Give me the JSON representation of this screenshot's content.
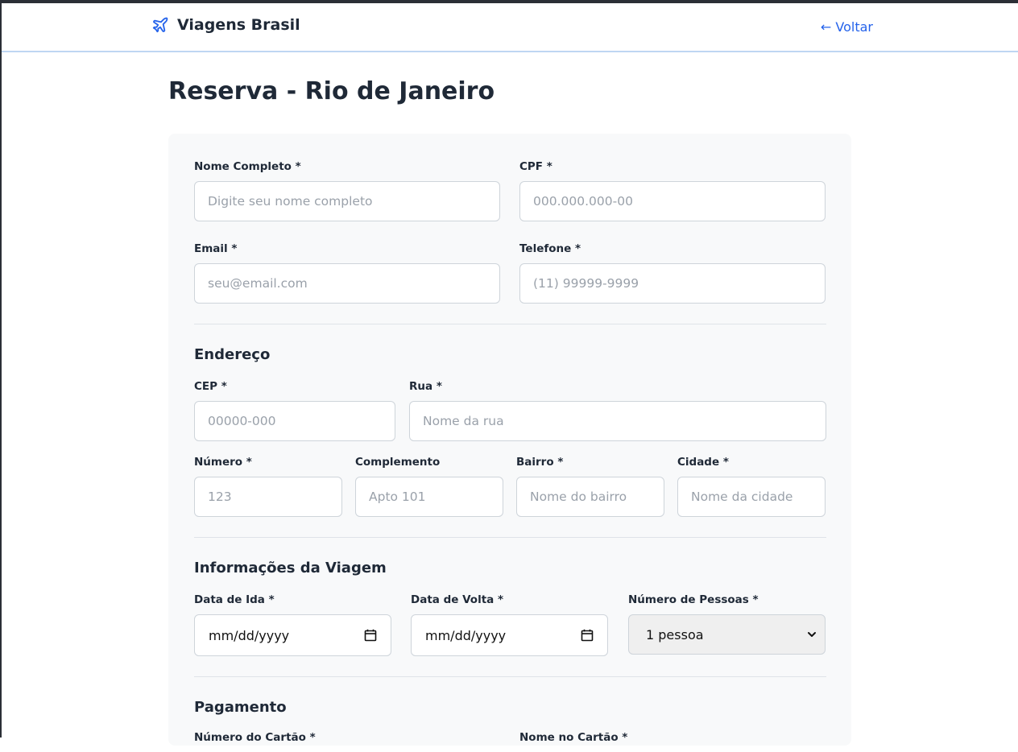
{
  "header": {
    "brand": "Viagens Brasil",
    "back_label": "← Voltar"
  },
  "page": {
    "title": "Reserva - Rio de Janeiro"
  },
  "personal": {
    "name_label": "Nome Completo *",
    "name_placeholder": "Digite seu nome completo",
    "cpf_label": "CPF *",
    "cpf_placeholder": "000.000.000-00",
    "email_label": "Email *",
    "email_placeholder": "seu@email.com",
    "phone_label": "Telefone *",
    "phone_placeholder": "(11) 99999-9999"
  },
  "address": {
    "title": "Endereço",
    "cep_label": "CEP *",
    "cep_placeholder": "00000-000",
    "street_label": "Rua *",
    "street_placeholder": "Nome da rua",
    "number_label": "Número *",
    "number_placeholder": "123",
    "complement_label": "Complemento",
    "complement_placeholder": "Apto 101",
    "district_label": "Bairro *",
    "district_placeholder": "Nome do bairro",
    "city_label": "Cidade *",
    "city_placeholder": "Nome da cidade"
  },
  "trip": {
    "title": "Informações da Viagem",
    "departure_label": "Data de Ida *",
    "departure_value": "mm/dd/yyyy",
    "return_label": "Data de Volta *",
    "return_value": "mm/dd/yyyy",
    "people_label": "Número de Pessoas *",
    "people_selected": "1 pessoa"
  },
  "payment": {
    "title": "Pagamento",
    "card_number_label": "Número do Cartão *",
    "card_name_label": "Nome no Cartão *"
  },
  "icons": {
    "brand": "plane-icon",
    "date": "calendar-icon",
    "select": "chevron-down-icon"
  },
  "colors": {
    "accent": "#2563eb",
    "card_bg": "#f8f9fa"
  }
}
